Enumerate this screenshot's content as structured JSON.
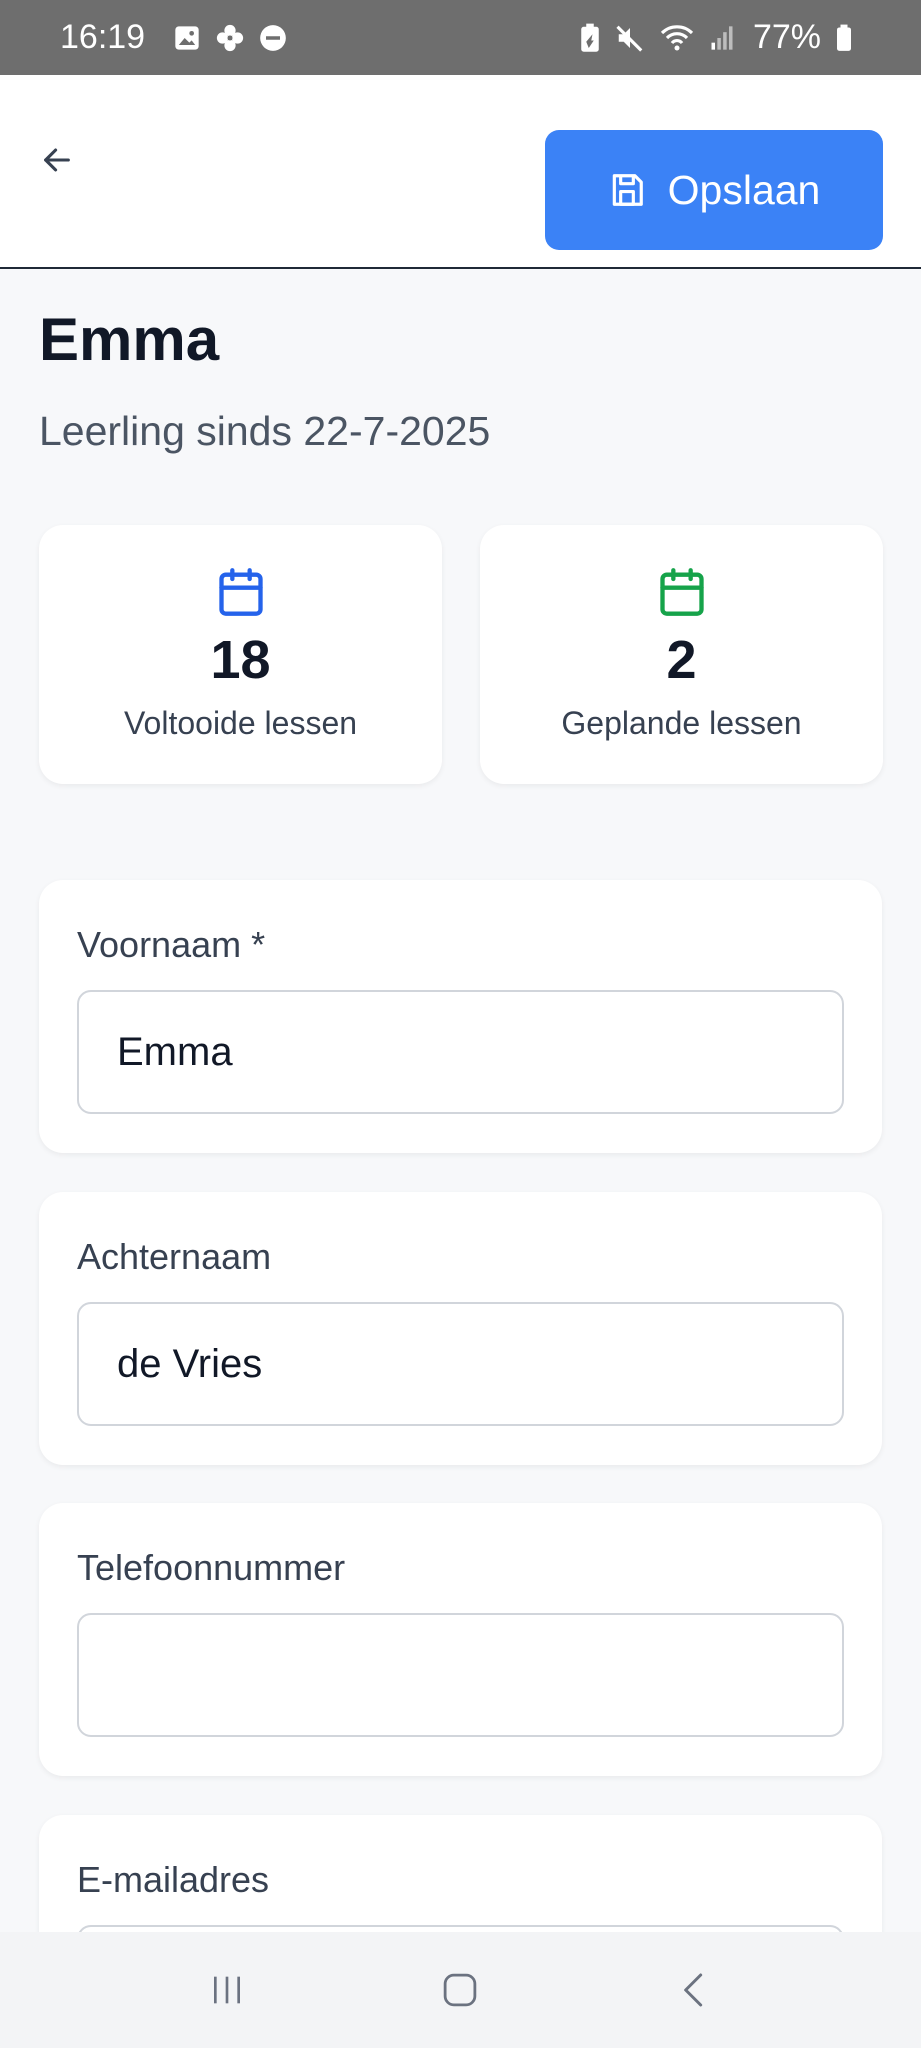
{
  "status_bar": {
    "time": "16:19",
    "battery_percent": "77%",
    "left_icons": [
      "image-icon",
      "pinwheel-icon",
      "do-not-disturb-icon"
    ],
    "right_icons": [
      "battery-saver-icon",
      "mute-icon",
      "wifi-icon",
      "signal-icon",
      "battery-icon"
    ]
  },
  "header": {
    "back_icon": "arrow-left-icon",
    "save_label": "Opslaan",
    "save_icon": "floppy-disk-icon",
    "accent_color": "#3b82f6"
  },
  "student": {
    "name": "Emma",
    "since": "Leerling sinds 22-7-2025"
  },
  "stats": [
    {
      "value": "18",
      "label": "Voltooide lessen",
      "icon": "calendar-icon",
      "color": "#2563eb"
    },
    {
      "value": "2",
      "label": "Geplande lessen",
      "icon": "calendar-icon",
      "color": "#16a34a"
    }
  ],
  "form": {
    "first_name": {
      "label": "Voornaam *",
      "value": "Emma"
    },
    "last_name": {
      "label": "Achternaam",
      "value": "de Vries"
    },
    "phone": {
      "label": "Telefoonnummer",
      "value": ""
    },
    "email": {
      "label": "E-mailadres",
      "value": ""
    }
  },
  "nav_bar": {
    "icons": [
      "recent-apps-icon",
      "home-icon",
      "back-icon"
    ]
  }
}
